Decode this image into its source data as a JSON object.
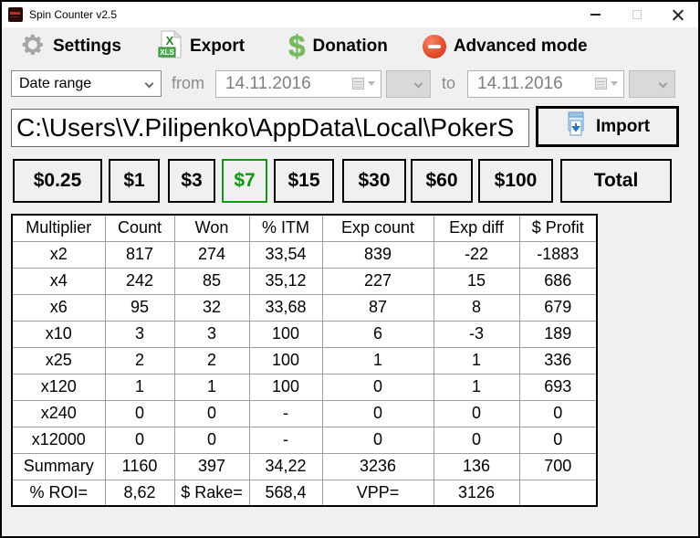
{
  "window": {
    "title": "Spin Counter v2.5"
  },
  "toolbar": {
    "settings_label": "Settings",
    "export_label": "Export",
    "export_badge": "XLS",
    "export_letter": "X",
    "donation_label": "Donation",
    "donation_glyph": "$",
    "advanced_label": "Advanced mode"
  },
  "filters": {
    "range_type": "Date range",
    "from_label": "from",
    "from_date": "14.11.2016",
    "to_label": "to",
    "to_date": "14.11.2016"
  },
  "path": {
    "value": "C:\\Users\\V.Pilipenko\\AppData\\Local\\PokerS",
    "import_label": "Import"
  },
  "stakes": {
    "buttons": [
      "$0.25",
      "$1",
      "$3",
      "$7",
      "$15",
      "$30",
      "$60",
      "$100",
      "Total"
    ],
    "selected_index": 3
  },
  "table": {
    "columns": [
      "Multiplier",
      "Count",
      "Won",
      "% ITM",
      "Exp count",
      "Exp diff",
      "$ Profit"
    ],
    "rows": [
      [
        "x2",
        "817",
        "274",
        "33,54",
        "839",
        "-22",
        "-1883"
      ],
      [
        "x4",
        "242",
        "85",
        "35,12",
        "227",
        "15",
        "686"
      ],
      [
        "x6",
        "95",
        "32",
        "33,68",
        "87",
        "8",
        "679"
      ],
      [
        "x10",
        "3",
        "3",
        "100",
        "6",
        "-3",
        "189"
      ],
      [
        "x25",
        "2",
        "2",
        "100",
        "1",
        "1",
        "336"
      ],
      [
        "x120",
        "1",
        "1",
        "100",
        "0",
        "1",
        "693"
      ],
      [
        "x240",
        "0",
        "0",
        "-",
        "0",
        "0",
        "0"
      ],
      [
        "x12000",
        "0",
        "0",
        "-",
        "0",
        "0",
        "0"
      ],
      [
        "Summary",
        "1160",
        "397",
        "34,22",
        "3236",
        "136",
        "700"
      ]
    ],
    "footer": {
      "roi_label": "% ROI=",
      "roi_value": "8,62",
      "rake_label": "$ Rake=",
      "rake_value": "568,4",
      "vpp_label": "VPP=",
      "vpp_value": "3126"
    }
  },
  "colors": {
    "positive": "#0d9b0d",
    "negative": "#e60000",
    "selected_stake": "#0d9b0d"
  }
}
